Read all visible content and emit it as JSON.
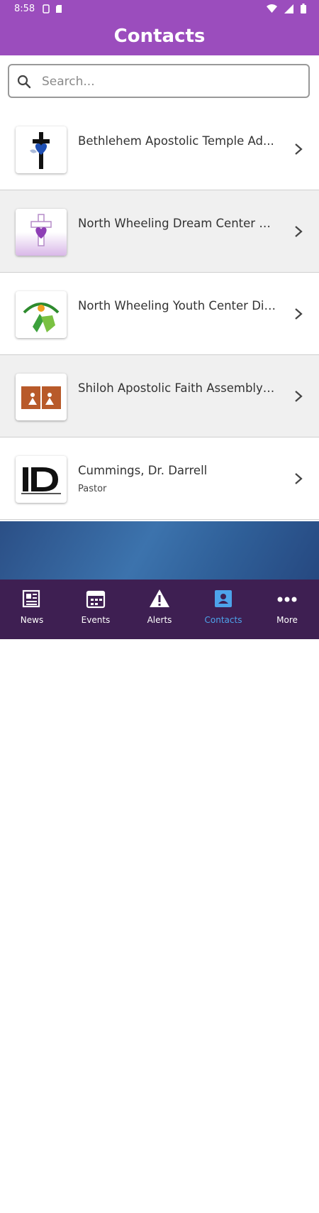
{
  "status": {
    "time": "8:58"
  },
  "header": {
    "title": "Contacts"
  },
  "search": {
    "placeholder": "Search..."
  },
  "contacts": [
    {
      "name": "Bethlehem Apostolic Temple Ad...",
      "subtitle": "",
      "logo": "cross-heart-logo"
    },
    {
      "name": "North Wheeling Dream Center Di...",
      "subtitle": "",
      "logo": "purple-cross-heart-logo"
    },
    {
      "name": "North Wheeling Youth Center Dir...",
      "subtitle": "",
      "logo": "youth-people-logo"
    },
    {
      "name": "Shiloh Apostolic Faith Assembly ...",
      "subtitle": "",
      "logo": "book-people-logo"
    },
    {
      "name": "Cummings, Dr. Darrell",
      "subtitle": "Pastor",
      "logo": "id-logo"
    }
  ],
  "nav": {
    "items": [
      {
        "label": "News",
        "icon": "newspaper-icon"
      },
      {
        "label": "Events",
        "icon": "calendar-icon"
      },
      {
        "label": "Alerts",
        "icon": "alert-icon"
      },
      {
        "label": "Contacts",
        "icon": "contact-card-icon",
        "active": true
      },
      {
        "label": "More",
        "icon": "more-dots-icon"
      }
    ]
  },
  "colors": {
    "primary": "#9b4dbd",
    "nav_bg": "#3e1f52",
    "active": "#4da3ea"
  }
}
